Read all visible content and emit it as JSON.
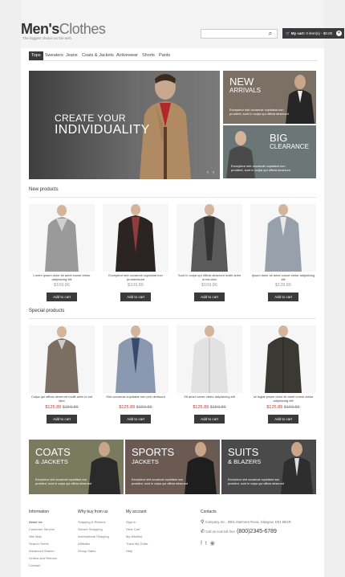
{
  "header": {
    "logo_bold": "Men's",
    "logo_light": "Clothes",
    "tagline": "The biggest choice on the web",
    "cart_label": "My cart:",
    "cart_value": "0 item(s) - $0.00"
  },
  "nav": {
    "items": [
      "Tops",
      "Sweaters",
      "Jeans",
      "Coats & Jackets",
      "Activewear",
      "Shorts",
      "Pants"
    ]
  },
  "hero": {
    "line1": "CREATE YOUR",
    "line2": "INDIVIDUALITY"
  },
  "promos": [
    {
      "title1": "NEW",
      "title2": "ARRIVALS",
      "text": "Excepteur sint occaecat cupidatat non proident, sunt in culpa qui officia deserunt"
    },
    {
      "title1": "BIG",
      "title2": "CLEARANCE",
      "text": "Excepteur sint occaecat cupidatat non proident, sunt in culpa qui officia deserunt"
    }
  ],
  "new_products": {
    "title": "New products",
    "items": [
      {
        "name": "Lorem ipsum dolor sit amet conse ctetur adipisicing elit",
        "price": "$109.86",
        "button": "Add to cart"
      },
      {
        "name": "Excepteur sint occaecat cupidatat non proidentsunt",
        "price": "$109.86",
        "button": "Add to cart"
      },
      {
        "name": "Sunt in culpa qui officia deserunt mollit anim id est labo",
        "price": "$109.86",
        "button": "Add to cart"
      },
      {
        "name": "Ipsum dolor sit amet conse ctetur adipisicing elit",
        "price": "$128.86",
        "button": "Add to cart"
      }
    ]
  },
  "special_products": {
    "title": "Special products",
    "items": [
      {
        "name": "Culpa qui officia deserunt mollit anim id est labo",
        "sale": "$125.89",
        "old": "$159.86",
        "button": "Add to cart"
      },
      {
        "name": "Sint occaecat cupidatat non proi dentsunt",
        "sale": "$125.89",
        "old": "$159.86",
        "button": "Add to cart"
      },
      {
        "name": "Sit amet conse ctetur adipisicing elit",
        "sale": "$125.89",
        "old": "$159.86",
        "button": "Add to cart"
      },
      {
        "name": "Ut fugiat ipsum dolor sit amet conse ctetur adipisicing elit",
        "sale": "$125.89",
        "old": "$169.86",
        "button": "Add to cart"
      }
    ]
  },
  "banners": [
    {
      "title1": "COATS",
      "title2": "& JACKETS",
      "text": "Excepteur sint occaecat cupidatat non proident, sunt in culpa qui officia deserunt",
      "color": "#7a7a5e"
    },
    {
      "title1": "SPORTS",
      "title2": "JACKETS",
      "text": "Excepteur sint occaecat cupidatat non proident, sunt in culpa qui officia deserunt",
      "color": "#6a5a52"
    },
    {
      "title1": "SUITS",
      "title2": "& BLAZERS",
      "text": "Excepteur sint occaecat cupidatat non proident, sunt in culpa qui officia deserunt",
      "color": "#4a4a4a"
    }
  ],
  "footer": {
    "information": {
      "title": "Information",
      "links": [
        "About Us",
        "Customer Service",
        "Site Map",
        "Search Terms",
        "Advanced Search",
        "Orders and Returns",
        "Contact"
      ]
    },
    "why_buy": {
      "title": "Why buy from us",
      "links": [
        "Shipping & Returns",
        "Secure Shopping",
        "International Shipping",
        "Affiliates",
        "Group Sales"
      ]
    },
    "my_account": {
      "title": "My account",
      "links": [
        "Sign In",
        "View Cart",
        "My Wishlist",
        "Track My Order",
        "Help"
      ]
    },
    "contacts": {
      "title": "Contacts",
      "address": "Company Inc., 8901 Marmora Road, Glasgow, D04 89GR.",
      "call_label": "Call us now toll free:",
      "phone": "(800)2345-6789"
    }
  }
}
